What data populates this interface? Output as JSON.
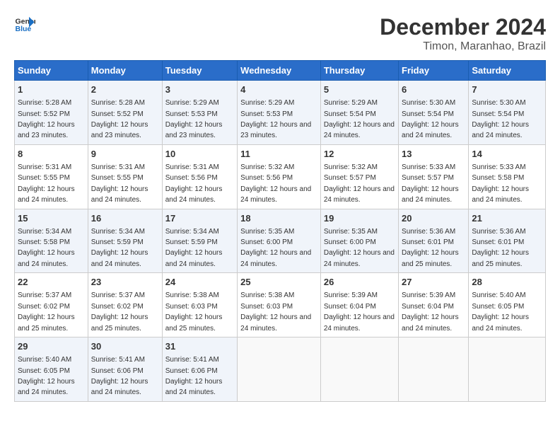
{
  "header": {
    "logo_line1": "General",
    "logo_line2": "Blue",
    "main_title": "December 2024",
    "sub_title": "Timon, Maranhao, Brazil"
  },
  "weekdays": [
    "Sunday",
    "Monday",
    "Tuesday",
    "Wednesday",
    "Thursday",
    "Friday",
    "Saturday"
  ],
  "weeks": [
    [
      {
        "day": "1",
        "sunrise": "Sunrise: 5:28 AM",
        "sunset": "Sunset: 5:52 PM",
        "daylight": "Daylight: 12 hours and 23 minutes."
      },
      {
        "day": "2",
        "sunrise": "Sunrise: 5:28 AM",
        "sunset": "Sunset: 5:52 PM",
        "daylight": "Daylight: 12 hours and 23 minutes."
      },
      {
        "day": "3",
        "sunrise": "Sunrise: 5:29 AM",
        "sunset": "Sunset: 5:53 PM",
        "daylight": "Daylight: 12 hours and 23 minutes."
      },
      {
        "day": "4",
        "sunrise": "Sunrise: 5:29 AM",
        "sunset": "Sunset: 5:53 PM",
        "daylight": "Daylight: 12 hours and 23 minutes."
      },
      {
        "day": "5",
        "sunrise": "Sunrise: 5:29 AM",
        "sunset": "Sunset: 5:54 PM",
        "daylight": "Daylight: 12 hours and 24 minutes."
      },
      {
        "day": "6",
        "sunrise": "Sunrise: 5:30 AM",
        "sunset": "Sunset: 5:54 PM",
        "daylight": "Daylight: 12 hours and 24 minutes."
      },
      {
        "day": "7",
        "sunrise": "Sunrise: 5:30 AM",
        "sunset": "Sunset: 5:54 PM",
        "daylight": "Daylight: 12 hours and 24 minutes."
      }
    ],
    [
      {
        "day": "8",
        "sunrise": "Sunrise: 5:31 AM",
        "sunset": "Sunset: 5:55 PM",
        "daylight": "Daylight: 12 hours and 24 minutes."
      },
      {
        "day": "9",
        "sunrise": "Sunrise: 5:31 AM",
        "sunset": "Sunset: 5:55 PM",
        "daylight": "Daylight: 12 hours and 24 minutes."
      },
      {
        "day": "10",
        "sunrise": "Sunrise: 5:31 AM",
        "sunset": "Sunset: 5:56 PM",
        "daylight": "Daylight: 12 hours and 24 minutes."
      },
      {
        "day": "11",
        "sunrise": "Sunrise: 5:32 AM",
        "sunset": "Sunset: 5:56 PM",
        "daylight": "Daylight: 12 hours and 24 minutes."
      },
      {
        "day": "12",
        "sunrise": "Sunrise: 5:32 AM",
        "sunset": "Sunset: 5:57 PM",
        "daylight": "Daylight: 12 hours and 24 minutes."
      },
      {
        "day": "13",
        "sunrise": "Sunrise: 5:33 AM",
        "sunset": "Sunset: 5:57 PM",
        "daylight": "Daylight: 12 hours and 24 minutes."
      },
      {
        "day": "14",
        "sunrise": "Sunrise: 5:33 AM",
        "sunset": "Sunset: 5:58 PM",
        "daylight": "Daylight: 12 hours and 24 minutes."
      }
    ],
    [
      {
        "day": "15",
        "sunrise": "Sunrise: 5:34 AM",
        "sunset": "Sunset: 5:58 PM",
        "daylight": "Daylight: 12 hours and 24 minutes."
      },
      {
        "day": "16",
        "sunrise": "Sunrise: 5:34 AM",
        "sunset": "Sunset: 5:59 PM",
        "daylight": "Daylight: 12 hours and 24 minutes."
      },
      {
        "day": "17",
        "sunrise": "Sunrise: 5:34 AM",
        "sunset": "Sunset: 5:59 PM",
        "daylight": "Daylight: 12 hours and 24 minutes."
      },
      {
        "day": "18",
        "sunrise": "Sunrise: 5:35 AM",
        "sunset": "Sunset: 6:00 PM",
        "daylight": "Daylight: 12 hours and 24 minutes."
      },
      {
        "day": "19",
        "sunrise": "Sunrise: 5:35 AM",
        "sunset": "Sunset: 6:00 PM",
        "daylight": "Daylight: 12 hours and 24 minutes."
      },
      {
        "day": "20",
        "sunrise": "Sunrise: 5:36 AM",
        "sunset": "Sunset: 6:01 PM",
        "daylight": "Daylight: 12 hours and 25 minutes."
      },
      {
        "day": "21",
        "sunrise": "Sunrise: 5:36 AM",
        "sunset": "Sunset: 6:01 PM",
        "daylight": "Daylight: 12 hours and 25 minutes."
      }
    ],
    [
      {
        "day": "22",
        "sunrise": "Sunrise: 5:37 AM",
        "sunset": "Sunset: 6:02 PM",
        "daylight": "Daylight: 12 hours and 25 minutes."
      },
      {
        "day": "23",
        "sunrise": "Sunrise: 5:37 AM",
        "sunset": "Sunset: 6:02 PM",
        "daylight": "Daylight: 12 hours and 25 minutes."
      },
      {
        "day": "24",
        "sunrise": "Sunrise: 5:38 AM",
        "sunset": "Sunset: 6:03 PM",
        "daylight": "Daylight: 12 hours and 25 minutes."
      },
      {
        "day": "25",
        "sunrise": "Sunrise: 5:38 AM",
        "sunset": "Sunset: 6:03 PM",
        "daylight": "Daylight: 12 hours and 24 minutes."
      },
      {
        "day": "26",
        "sunrise": "Sunrise: 5:39 AM",
        "sunset": "Sunset: 6:04 PM",
        "daylight": "Daylight: 12 hours and 24 minutes."
      },
      {
        "day": "27",
        "sunrise": "Sunrise: 5:39 AM",
        "sunset": "Sunset: 6:04 PM",
        "daylight": "Daylight: 12 hours and 24 minutes."
      },
      {
        "day": "28",
        "sunrise": "Sunrise: 5:40 AM",
        "sunset": "Sunset: 6:05 PM",
        "daylight": "Daylight: 12 hours and 24 minutes."
      }
    ],
    [
      {
        "day": "29",
        "sunrise": "Sunrise: 5:40 AM",
        "sunset": "Sunset: 6:05 PM",
        "daylight": "Daylight: 12 hours and 24 minutes."
      },
      {
        "day": "30",
        "sunrise": "Sunrise: 5:41 AM",
        "sunset": "Sunset: 6:06 PM",
        "daylight": "Daylight: 12 hours and 24 minutes."
      },
      {
        "day": "31",
        "sunrise": "Sunrise: 5:41 AM",
        "sunset": "Sunset: 6:06 PM",
        "daylight": "Daylight: 12 hours and 24 minutes."
      },
      null,
      null,
      null,
      null
    ]
  ]
}
